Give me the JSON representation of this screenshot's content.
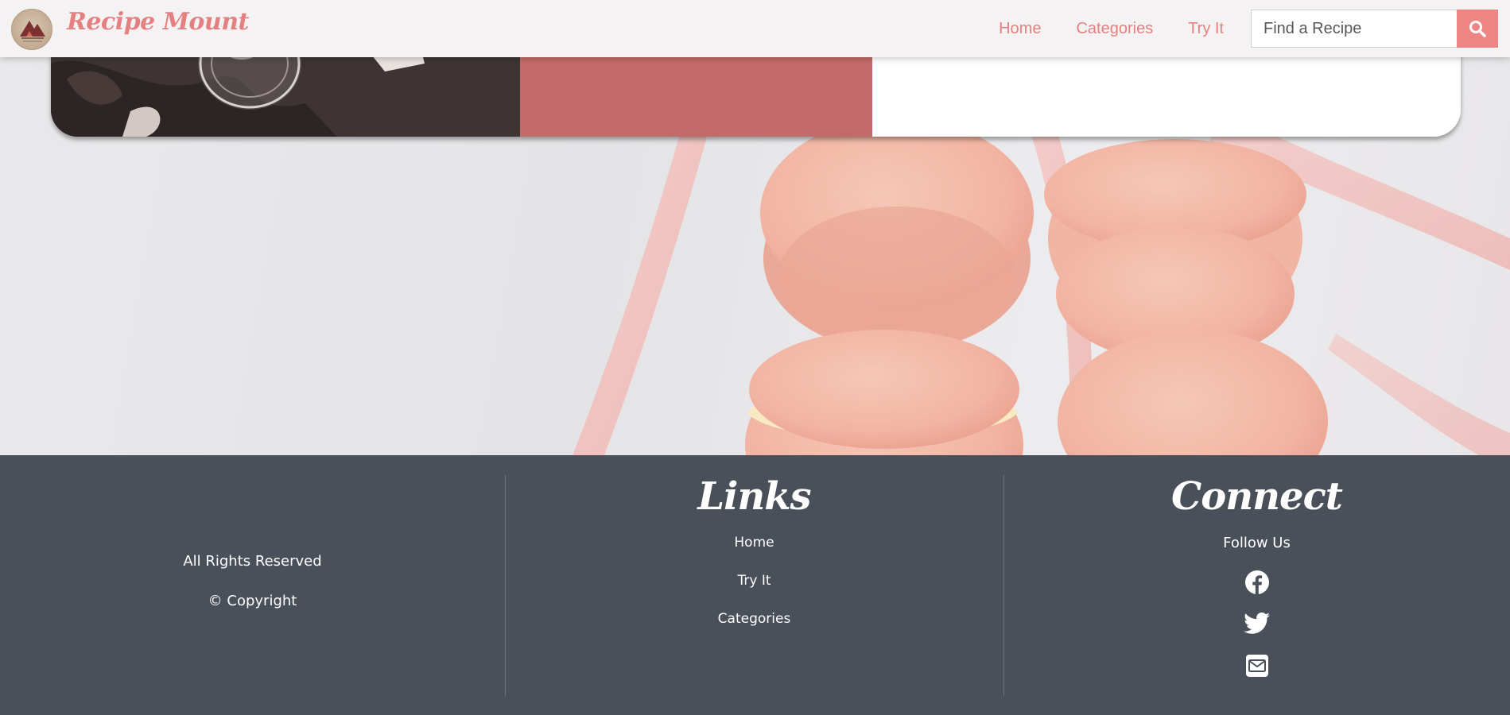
{
  "navbar": {
    "brand": "Recipe Mount",
    "links": [
      {
        "label": "Home"
      },
      {
        "label": "Categories"
      },
      {
        "label": "Try It"
      }
    ],
    "search": {
      "placeholder": "Find a Recipe",
      "value": "",
      "icon": "search-icon"
    }
  },
  "card": {
    "accent_color": "#c56a6a",
    "photo_icon": "jar-photo"
  },
  "hero": {
    "image_icon": "macarons-photo"
  },
  "footer": {
    "rights": "All Rights Reserved",
    "copyright": "© Copyright",
    "links_heading": "Links",
    "links": [
      {
        "label": "Home"
      },
      {
        "label": "Try It"
      },
      {
        "label": "Categories"
      }
    ],
    "connect_heading": "Connect",
    "follow_label": "Follow Us",
    "social": [
      {
        "icon": "facebook-icon"
      },
      {
        "icon": "twitter-icon"
      },
      {
        "icon": "envelope-icon"
      }
    ]
  },
  "colors": {
    "brand": "#e58080",
    "search_button": "#ee8585",
    "footer_bg": "#495059",
    "navbar_bg": "#f5f2f3"
  }
}
